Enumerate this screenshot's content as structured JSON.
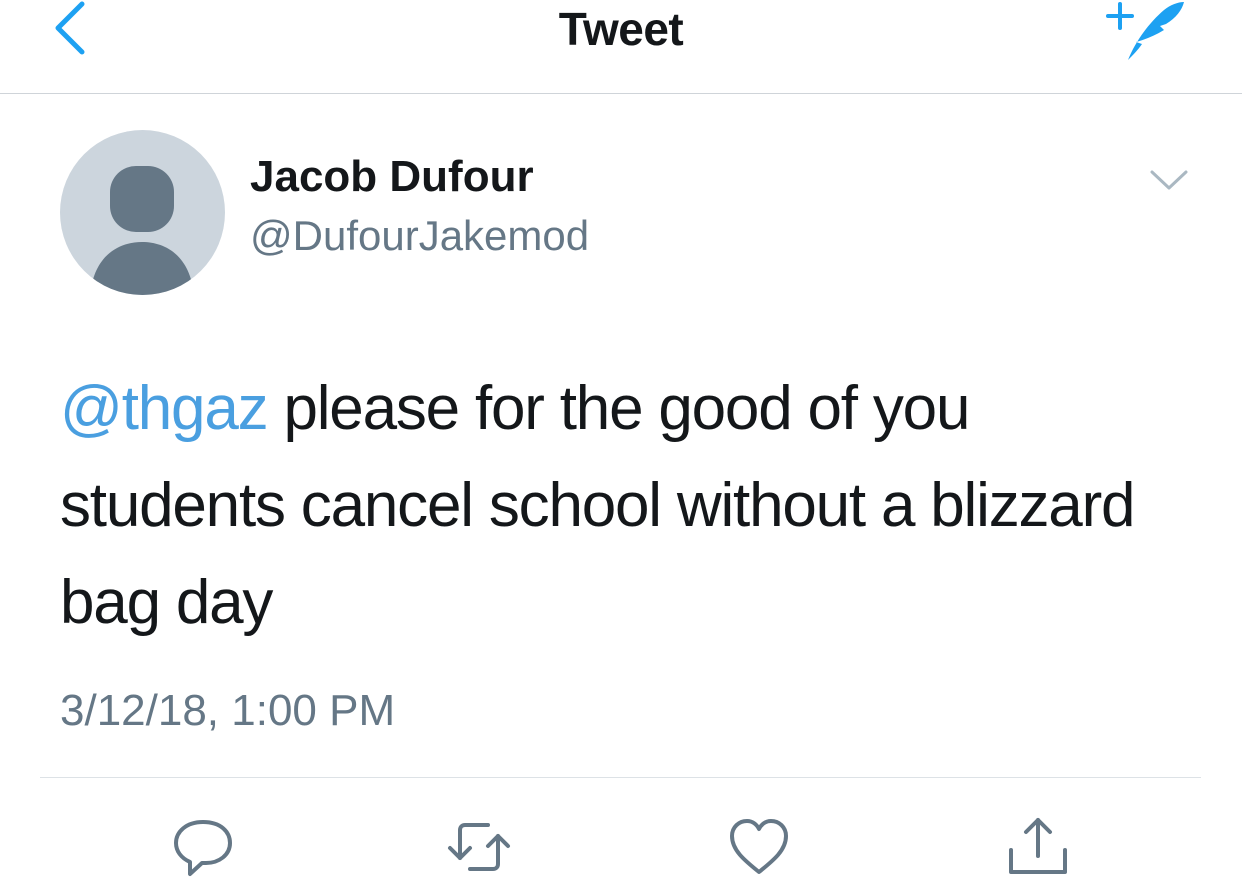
{
  "header": {
    "title": "Tweet",
    "back_icon": "chevron-left-icon",
    "compose_icon": "compose-quill-icon"
  },
  "tweet": {
    "author_name": "Jacob Dufour",
    "author_handle": "@DufourJakemod",
    "mention": "@thgaz",
    "body": "please for the good of you students cancel school without a blizzard bag day",
    "timestamp": "3/12/18, 1:00 PM"
  },
  "actions": [
    {
      "name": "reply",
      "icon": "reply-icon"
    },
    {
      "name": "retweet",
      "icon": "retweet-icon"
    },
    {
      "name": "like",
      "icon": "heart-icon"
    },
    {
      "name": "share",
      "icon": "share-icon"
    }
  ],
  "colors": {
    "accent": "#1da1f2",
    "text": "#14171a",
    "secondary": "#657786",
    "avatar_bg": "#ccd5dd",
    "avatar_fg": "#657786"
  }
}
